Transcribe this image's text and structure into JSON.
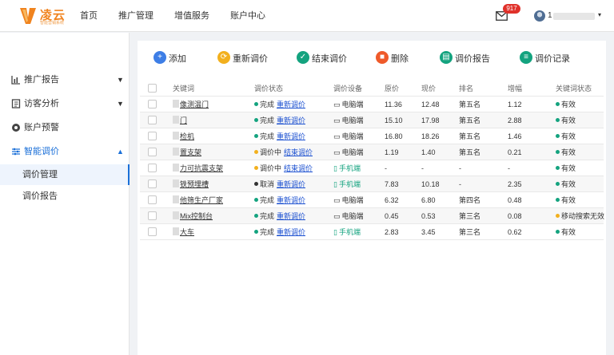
{
  "header": {
    "logo_text": "凌云",
    "logo_sub": "智能营销系统",
    "nav": [
      "首页",
      "推广管理",
      "增值服务",
      "账户中心"
    ],
    "mail_badge": "917",
    "user_name": "1",
    "user_caret": "▾"
  },
  "sidebar": {
    "items": [
      {
        "icon": "bar-chart-icon",
        "label": "推广报告",
        "caret": "▼"
      },
      {
        "icon": "document-icon",
        "label": "访客分析",
        "caret": "▼"
      },
      {
        "icon": "alert-icon",
        "label": "账户预警"
      },
      {
        "icon": "sliders-icon",
        "label": "智能调价",
        "caret": "▲"
      }
    ],
    "sub_items": [
      "调价管理",
      "调价报告"
    ]
  },
  "toolbar": [
    {
      "icon": "plus-icon",
      "glyph": "+",
      "color": "#3d7ee6",
      "label": "添加"
    },
    {
      "icon": "refresh-icon",
      "glyph": "⟳",
      "color": "#f2b01e",
      "label": "重新调价"
    },
    {
      "icon": "check-icon",
      "glyph": "✓",
      "color": "#14a37f",
      "label": "结束调价"
    },
    {
      "icon": "trash-icon",
      "glyph": "■",
      "color": "#ef5a2a",
      "label": "删除"
    },
    {
      "icon": "report-icon",
      "glyph": "▤",
      "color": "#14a37f",
      "label": "调价报告"
    },
    {
      "icon": "record-icon",
      "glyph": "≡",
      "color": "#14a37f",
      "label": "调价记录"
    }
  ],
  "table": {
    "columns": [
      "关键词",
      "调价状态",
      "调价设备",
      "原价",
      "现价",
      "排名",
      "增幅",
      "关键词状态"
    ],
    "rows": [
      {
        "keyword": "像测温门",
        "status": "完成",
        "status_color": "#14a37f",
        "action": "重新调价",
        "device": "电脑端",
        "device_type": "pc",
        "orig": "11.36",
        "now": "12.48",
        "rank": "第五名",
        "gain": "1.12",
        "kw_status": "有效",
        "kw_status_color": "#14a37f"
      },
      {
        "keyword": "门",
        "status": "完成",
        "status_color": "#14a37f",
        "action": "重新调价",
        "device": "电脑端",
        "device_type": "pc",
        "orig": "15.10",
        "now": "17.98",
        "rank": "第五名",
        "gain": "2.88",
        "kw_status": "有效",
        "kw_status_color": "#14a37f"
      },
      {
        "keyword": "检机",
        "status": "完成",
        "status_color": "#14a37f",
        "action": "重新调价",
        "device": "电脑端",
        "device_type": "pc",
        "orig": "16.80",
        "now": "18.26",
        "rank": "第五名",
        "gain": "1.46",
        "kw_status": "有效",
        "kw_status_color": "#14a37f"
      },
      {
        "keyword": "置支架",
        "status": "调价中",
        "status_color": "#f2b01e",
        "action": "结束调价",
        "device": "电脑端",
        "device_type": "pc",
        "orig": "1.19",
        "now": "1.40",
        "rank": "第五名",
        "gain": "0.21",
        "kw_status": "有效",
        "kw_status_color": "#14a37f"
      },
      {
        "keyword": "力可抗震支架",
        "status": "调价中",
        "status_color": "#f2b01e",
        "action": "结束调价",
        "device": "手机端",
        "device_type": "mobile",
        "orig": "-",
        "now": "-",
        "rank": "-",
        "gain": "-",
        "kw_status": "有效",
        "kw_status_color": "#14a37f"
      },
      {
        "keyword": "铁预埋槽",
        "status": "取消",
        "status_color": "#333333",
        "action": "重新调价",
        "device": "手机端",
        "device_type": "mobile",
        "orig": "7.83",
        "now": "10.18",
        "rank": "-",
        "gain": "2.35",
        "kw_status": "有效",
        "kw_status_color": "#14a37f"
      },
      {
        "keyword": "他筛生产厂家",
        "status": "完成",
        "status_color": "#14a37f",
        "action": "重新调价",
        "device": "电脑端",
        "device_type": "pc",
        "orig": "6.32",
        "now": "6.80",
        "rank": "第四名",
        "gain": "0.48",
        "kw_status": "有效",
        "kw_status_color": "#14a37f"
      },
      {
        "keyword": "Mix控制台",
        "status": "完成",
        "status_color": "#14a37f",
        "action": "重新调价",
        "device": "电脑端",
        "device_type": "pc",
        "orig": "0.45",
        "now": "0.53",
        "rank": "第三名",
        "gain": "0.08",
        "kw_status": "移动搜索无效",
        "kw_status_color": "#f2b01e"
      },
      {
        "keyword": "大车",
        "status": "完成",
        "status_color": "#14a37f",
        "action": "重新调价",
        "device": "手机端",
        "device_type": "mobile",
        "orig": "2.83",
        "now": "3.45",
        "rank": "第三名",
        "gain": "0.62",
        "kw_status": "有效",
        "kw_status_color": "#14a37f"
      }
    ]
  },
  "colors": {
    "accent": "#1a6fd8",
    "brand": "#f0831e",
    "success": "#14a37f",
    "warning": "#f2b01e",
    "badge": "#e0312a"
  }
}
